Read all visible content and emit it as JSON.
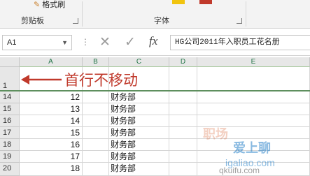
{
  "ribbon": {
    "format_painter_label": "格式刷",
    "clipboard_group": "剪贴板",
    "font_group": "字体"
  },
  "formula_bar": {
    "name_box": "A1",
    "more": "⋮",
    "cancel_symbol": "✕",
    "enter_symbol": "✓",
    "fx_label": "fx",
    "formula": "HG公司2011年入职员工花名册"
  },
  "grid": {
    "columns": [
      "A",
      "B",
      "C",
      "D",
      "E"
    ],
    "rows": [
      {
        "row": "1",
        "a": "",
        "c": ""
      },
      {
        "row": "14",
        "a": "12",
        "c": "财务部"
      },
      {
        "row": "15",
        "a": "13",
        "c": "财务部"
      },
      {
        "row": "16",
        "a": "14",
        "c": "财务部"
      },
      {
        "row": "17",
        "a": "15",
        "c": "财务部"
      },
      {
        "row": "18",
        "a": "16",
        "c": "财务部"
      },
      {
        "row": "19",
        "a": "17",
        "c": "财务部"
      },
      {
        "row": "20",
        "a": "18",
        "c": "财务部"
      }
    ]
  },
  "annotation": "首行不移动",
  "watermark": {
    "line1": "职场",
    "line2": "爱上聊",
    "line3": "igaliao.com",
    "line4": "qkuifu.com"
  },
  "colors": {
    "annotation": "#c0392b",
    "freeze_line": "#5e8f5e",
    "header_text": "#217346"
  }
}
